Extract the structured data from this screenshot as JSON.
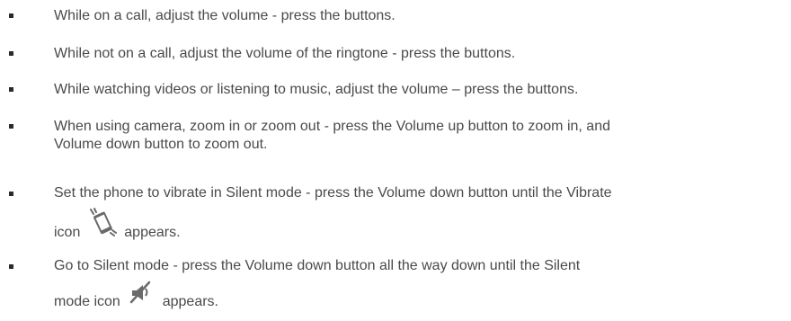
{
  "items": [
    {
      "text": "While on a call, adjust the volume - press the buttons."
    },
    {
      "text": "While not on a call, adjust the volume of the ringtone - press the buttons."
    },
    {
      "text": "While watching videos or listening to music, adjust the volume – press the buttons."
    },
    {
      "line1": "When using camera, zoom in or zoom out - press the Volume up button to zoom in, and",
      "line2": "Volume down button to zoom out."
    },
    {
      "line1": "Set the phone to vibrate in Silent mode - press the Volume down button until the Vibrate",
      "before_icon": "icon",
      "after_icon": "appears.",
      "icon": "vibrate-icon"
    },
    {
      "line1": "Go to Silent mode - press the Volume down button all the way down until the Silent",
      "before_icon": "mode icon",
      "after_icon": "appears.",
      "icon": "mute-icon"
    }
  ]
}
